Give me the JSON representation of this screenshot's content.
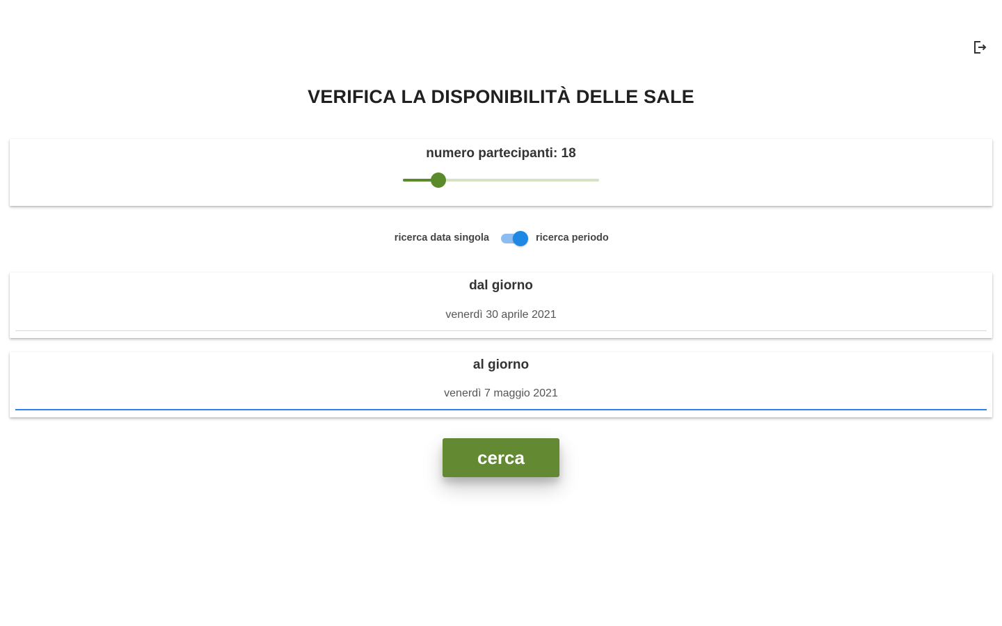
{
  "header": {
    "logout_icon": "logout-icon"
  },
  "page": {
    "title": "VERIFICA LA DISPONIBILITÀ DELLE SALE"
  },
  "participants": {
    "label": "numero partecipanti: 18",
    "value": 18,
    "slider_fill_fraction": 0.18,
    "accent_color": "#5a8a2a"
  },
  "search_mode": {
    "left_label": "ricerca data singola",
    "right_label": "ricerca periodo",
    "toggle_on": true,
    "toggle_color": "#1e88e5"
  },
  "from_day": {
    "label": "dal giorno",
    "value": "venerdì 30 aprile 2021"
  },
  "to_day": {
    "label": "al giorno",
    "value": "venerdì 7 maggio 2021"
  },
  "search_button": {
    "label": "cerca",
    "color": "#638a33"
  }
}
